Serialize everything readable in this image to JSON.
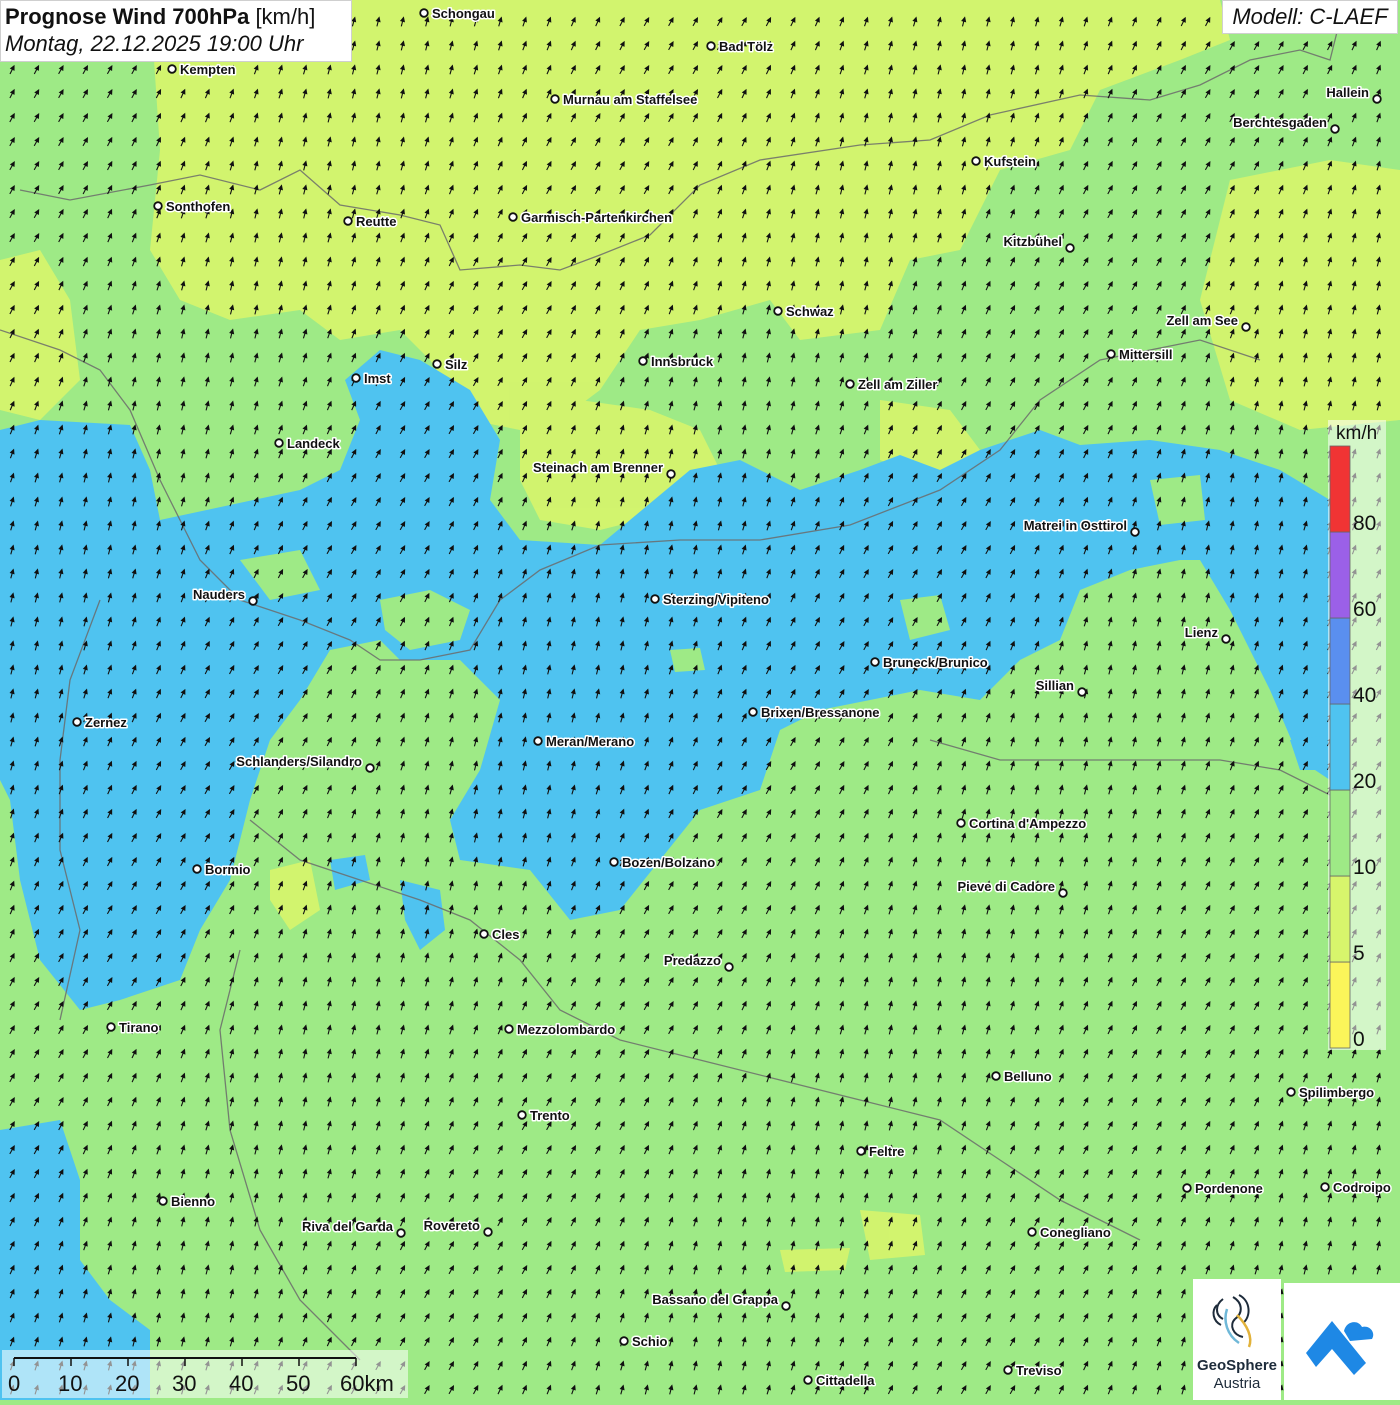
{
  "header": {
    "title_bold": "Prognose Wind 700hPa",
    "title_unit": "[km/h]",
    "date": "Montag, 22.12.2025 19:00 Uhr",
    "model": "Modell: C-LAEF"
  },
  "legend": {
    "unit": "km/h",
    "colors": [
      "#fbf55a",
      "#d7f56c",
      "#9eea86",
      "#4fc3f0",
      "#5a8fef",
      "#9b60e8",
      "#f03434"
    ],
    "labels": [
      "0",
      "5",
      "10",
      "20",
      "40",
      "60",
      "80"
    ]
  },
  "scale_bar": {
    "labels": [
      "0",
      "10",
      "20",
      "30",
      "40",
      "50",
      "60km"
    ]
  },
  "logo": {
    "name_line1": "GeoSphere",
    "name_line2": "Austria"
  },
  "cities": [
    {
      "name": "Schongau"
    },
    {
      "name": "Bad Tölz"
    },
    {
      "name": "Kempten"
    },
    {
      "name": "Murnau am Staffelsee"
    },
    {
      "name": "Hallein"
    },
    {
      "name": "Berchtesgaden"
    },
    {
      "name": "Kufstein"
    },
    {
      "name": "Sonthofen"
    },
    {
      "name": "Reutte"
    },
    {
      "name": "Garmisch-Partenkirchen"
    },
    {
      "name": "Kitzbühel"
    },
    {
      "name": "Schwaz"
    },
    {
      "name": "Zell am See"
    },
    {
      "name": "Mittersill"
    },
    {
      "name": "Innsbruck"
    },
    {
      "name": "Silz"
    },
    {
      "name": "Imst"
    },
    {
      "name": "Zell am Ziller"
    },
    {
      "name": "Landeck"
    },
    {
      "name": "Steinach am Brenner"
    },
    {
      "name": "Matrei in Osttirol"
    },
    {
      "name": "Nauders"
    },
    {
      "name": "Sterzing/Vipiteno"
    },
    {
      "name": "Lienz"
    },
    {
      "name": "Bruneck/Brunico"
    },
    {
      "name": "Sillian"
    },
    {
      "name": "Zernez"
    },
    {
      "name": "Brixen/Bressanone"
    },
    {
      "name": "Meran/Merano"
    },
    {
      "name": "Schlanders/Silandro"
    },
    {
      "name": "Cortina d'Ampezzo"
    },
    {
      "name": "Bozen/Bolzano"
    },
    {
      "name": "Bormio"
    },
    {
      "name": "Pieve di Cadore"
    },
    {
      "name": "Cles"
    },
    {
      "name": "Predazzo"
    },
    {
      "name": "Tirano"
    },
    {
      "name": "Mezzolombardo"
    },
    {
      "name": "Belluno"
    },
    {
      "name": "Spilimbergo"
    },
    {
      "name": "Trento"
    },
    {
      "name": "Feltre"
    },
    {
      "name": "Pordenone"
    },
    {
      "name": "Codroipo"
    },
    {
      "name": "Bienno"
    },
    {
      "name": "Riva del Garda"
    },
    {
      "name": "Rovereto"
    },
    {
      "name": "Conegliano"
    },
    {
      "name": "Bassano del Grappa"
    },
    {
      "name": "Schio"
    },
    {
      "name": "Treviso"
    },
    {
      "name": "Cittadella"
    }
  ]
}
